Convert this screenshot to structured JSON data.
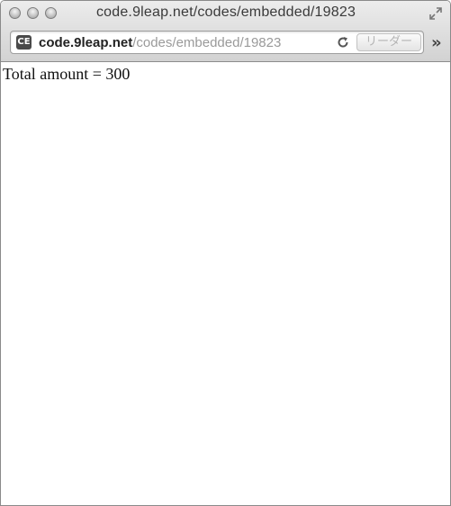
{
  "window": {
    "title": "code.9leap.net/codes/embedded/19823"
  },
  "toolbar": {
    "url_host": "code.9leap.net",
    "url_path": "/codes/embedded/19823",
    "reader_label": "リーダー",
    "overflow_label": "»",
    "favicon_text": "CE"
  },
  "page": {
    "output_text": "Total amount = 300"
  }
}
